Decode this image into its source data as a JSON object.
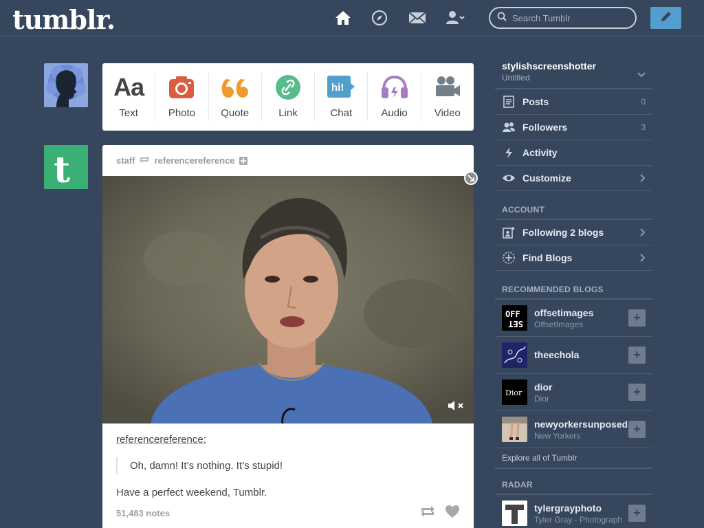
{
  "header": {
    "logo": "tumblr.",
    "search_placeholder": "Search Tumblr",
    "icons": [
      "home-icon",
      "explore-icon",
      "inbox-icon",
      "account-icon"
    ]
  },
  "post_types": [
    {
      "label": "Text",
      "icon": "text-icon",
      "color": "#444444"
    },
    {
      "label": "Photo",
      "icon": "camera-icon",
      "color": "#d95e40"
    },
    {
      "label": "Quote",
      "icon": "quote-icon",
      "color": "#f2992e"
    },
    {
      "label": "Link",
      "icon": "link-icon",
      "color": "#56bc8a"
    },
    {
      "label": "Chat",
      "icon": "chat-icon",
      "color": "#529ecc"
    },
    {
      "label": "Audio",
      "icon": "headphones-icon",
      "color": "#a77dc2"
    },
    {
      "label": "Video",
      "icon": "video-camera-icon",
      "color": "#748089"
    }
  ],
  "post": {
    "author": "staff",
    "reblogged_from": "referencereference",
    "source_name": "referencereference:",
    "quote": "Oh, damn! It’s nothing. It’s stupid!",
    "body": "Have a perfect weekend, Tumblr.",
    "notes": "51,483 notes"
  },
  "sidebar": {
    "blog_name": "stylishscreenshotter",
    "blog_subtitle": "Untitled",
    "rows": [
      {
        "label": "Posts",
        "count": "0",
        "icon": "posts-icon"
      },
      {
        "label": "Followers",
        "count": "3",
        "icon": "followers-icon"
      },
      {
        "label": "Activity",
        "icon": "activity-icon"
      },
      {
        "label": "Customize",
        "icon": "eye-icon"
      }
    ],
    "account_title": "ACCOUNT",
    "account_rows": [
      {
        "label": "Following 2 blogs",
        "icon": "following-icon"
      },
      {
        "label": "Find Blogs",
        "icon": "find-blogs-icon"
      }
    ],
    "recommended_title": "RECOMMENDED BLOGS",
    "recommended": [
      {
        "name": "offsetimages",
        "subtitle": "OffsetImages"
      },
      {
        "name": "theechola",
        "subtitle": ""
      },
      {
        "name": "dior",
        "subtitle": "Dior"
      },
      {
        "name": "newyorkersunposed",
        "subtitle": "New Yorkers"
      }
    ],
    "explore": "Explore all of Tumblr",
    "radar_title": "RADAR",
    "radar": {
      "name": "tylergrayphoto",
      "subtitle": "Tyler Gray - Photograph"
    }
  }
}
